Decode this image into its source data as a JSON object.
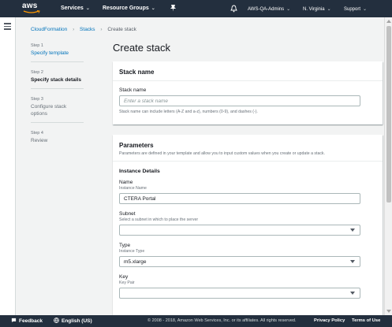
{
  "topnav": {
    "logo_text": "aws",
    "services": "Services",
    "resource_groups": "Resource Groups",
    "account": "AWS-QA-Admins",
    "region": "N. Virginia",
    "support": "Support"
  },
  "breadcrumb": {
    "root": "CloudFormation",
    "stacks": "Stacks",
    "current": "Create stack"
  },
  "steps": [
    {
      "num": "Step 1",
      "title": "Specify template"
    },
    {
      "num": "Step 2",
      "title": "Specify stack details"
    },
    {
      "num": "Step 3",
      "title": "Configure stack options"
    },
    {
      "num": "Step 4",
      "title": "Review"
    }
  ],
  "page_title": "Create stack",
  "stack_name_panel": {
    "title": "Stack name",
    "label": "Stack name",
    "placeholder": "Enter a stack name",
    "hint": "Stack name can include letters (A-Z and a-z), numbers (0-9), and dashes (-)."
  },
  "parameters_panel": {
    "title": "Parameters",
    "description": "Parameters are defined in your template and allow you to input custom values when you create or update a stack.",
    "group_title": "Instance Details",
    "fields": [
      {
        "label": "Name",
        "desc": "Instance Name",
        "value": "CTERA Portal"
      },
      {
        "label": "Subnet",
        "desc": "Select a subnet in which to place the server",
        "value": ""
      },
      {
        "label": "Type",
        "desc": "Instance Type",
        "value": "m5.xlarge"
      },
      {
        "label": "Key",
        "desc": "Key Pair",
        "value": ""
      }
    ]
  },
  "footer": {
    "feedback": "Feedback",
    "language": "English (US)",
    "copyright": "© 2008 - 2018, Amazon Web Services, Inc. or its affiliates. All rights reserved.",
    "privacy": "Privacy Policy",
    "terms": "Terms of Use"
  }
}
